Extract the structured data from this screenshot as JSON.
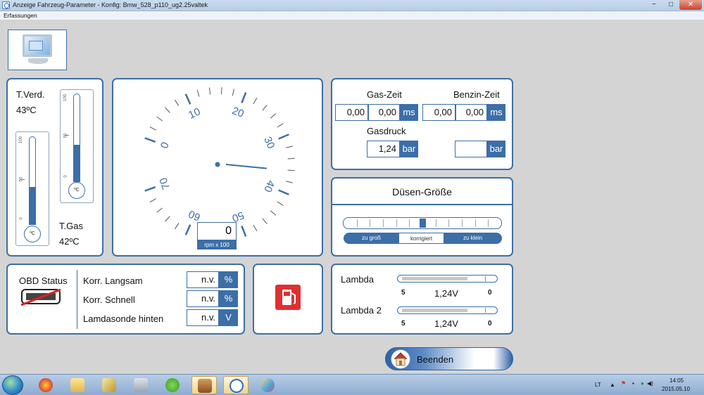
{
  "window": {
    "title": "Anzeige Fahrzeug-Parameter  - Konfig: Bmw_528_p110_ug2.25valtek",
    "minimize": "−",
    "maximize": "□",
    "close": "✕"
  },
  "menu": {
    "item": "Erfassungen"
  },
  "temperature": {
    "evaporator_label": "T.Verd.",
    "evaporator_value": "43ºC",
    "gas_label": "T.Gas",
    "gas_value": "42ºC",
    "thermo_unit": "ºC",
    "scale": [
      "100",
      "50",
      "0"
    ],
    "evaporator_level_pct": 43,
    "gas_level_pct": 42
  },
  "tachometer": {
    "scale": [
      "0",
      "10",
      "20",
      "30",
      "40",
      "50",
      "60",
      "70"
    ],
    "value": "0",
    "unit": "rpm x 100",
    "needle_value": 36
  },
  "times": {
    "gas_label": "Gas-Zeit",
    "gas_val1": "0,00",
    "gas_val2": "0,00",
    "gas_unit": "ms",
    "petrol_label": "Benzin-Zeit",
    "petrol_val1": "0,00",
    "petrol_val2": "0,00",
    "petrol_unit": "ms",
    "pressure_label": "Gasdruck",
    "pressure_value": "1,24",
    "pressure_unit": "bar",
    "pressure2_value": "",
    "pressure2_unit": "bar"
  },
  "nozzle": {
    "title": "Düsen-Größe",
    "segments": [
      "zu groß",
      "korrigiert",
      "zu klein"
    ],
    "position_pct": 50
  },
  "obd": {
    "title": "OBD Status",
    "rows": [
      {
        "label": "Korr. Langsam",
        "value": "n.v.",
        "unit": "%"
      },
      {
        "label": "Korr. Schnell",
        "value": "n.v.",
        "unit": "%"
      },
      {
        "label": "Lamdasonde hinten",
        "value": "n.v.",
        "unit": "V"
      }
    ]
  },
  "lambda": {
    "rows": [
      {
        "label": "Lambda",
        "min": "5",
        "value": "1,24V",
        "max": "0",
        "level_pct": 75
      },
      {
        "label": "Lambda 2",
        "min": "5",
        "value": "1,24V",
        "max": "0",
        "level_pct": 75
      }
    ]
  },
  "exit": {
    "label": "Beenden"
  },
  "taskbar": {
    "language": "LT",
    "time": "14:05",
    "date": "2015.05.10"
  }
}
